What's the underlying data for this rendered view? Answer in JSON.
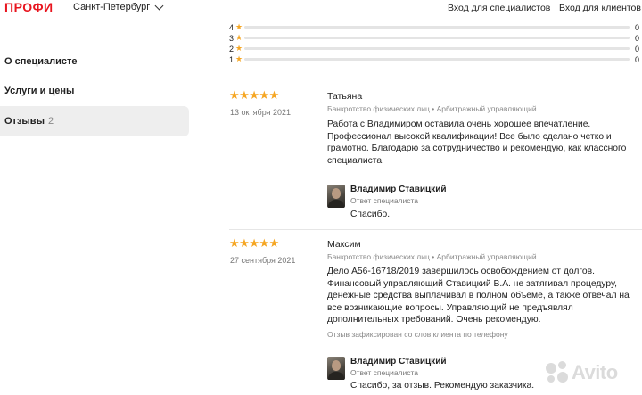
{
  "header": {
    "logo": "ПРОФИ",
    "city": "Санкт-Петербург",
    "login_specialists": "Вход для специалистов",
    "login_clients": "Вход для клиентов"
  },
  "sidebar": {
    "items": [
      {
        "label": "О специалисте"
      },
      {
        "label": "Услуги и цены"
      },
      {
        "label": "Отзывы",
        "count": "2"
      }
    ]
  },
  "rating_breakdown": [
    {
      "stars": "4",
      "count": "0"
    },
    {
      "stars": "3",
      "count": "0"
    },
    {
      "stars": "2",
      "count": "0"
    },
    {
      "stars": "1",
      "count": "0"
    }
  ],
  "reviews": [
    {
      "rating": 4.5,
      "stars_display": "★★★★★",
      "date": "13 октября 2021",
      "author": "Татьяна",
      "category": "Банкротство физических лиц • Арбитражный управляющий",
      "text": "Работа с Владимиром оставила очень хорошее впечатление. Профессионал высокой квалификации! Все было сделано четко и грамотно. Благодарю за сотрудничество и рекомендую, как классного специалиста.",
      "note": "",
      "reply": {
        "name": "Владимир Ставицкий",
        "role": "Ответ специалиста",
        "text": "Спасибо."
      }
    },
    {
      "rating": 4.5,
      "stars_display": "★★★★★",
      "date": "27 сентября 2021",
      "author": "Максим",
      "category": "Банкротство физических лиц • Арбитражный управляющий",
      "text": "Дело А56-16718/2019 завершилось освобождением от долгов. Финансовый управляющий Ставицкий В.А. не затягивал процедуру, денежные средства выплачивал в полном объеме, а также отвечал на все возникающие вопросы. Управляющий не предъявлял дополнительных требований. Очень рекомендую.",
      "note": "Отзыв зафиксирован со слов клиента по телефону",
      "reply": {
        "name": "Владимир Ставицкий",
        "role": "Ответ специалиста",
        "text": "Спасибо, за отзыв. Рекомендую заказчика."
      }
    }
  ],
  "watermark": {
    "text": "Avito"
  },
  "colors": {
    "brand": "#e8141e",
    "star": "#f5a623",
    "active_bg": "#eeeeee"
  }
}
